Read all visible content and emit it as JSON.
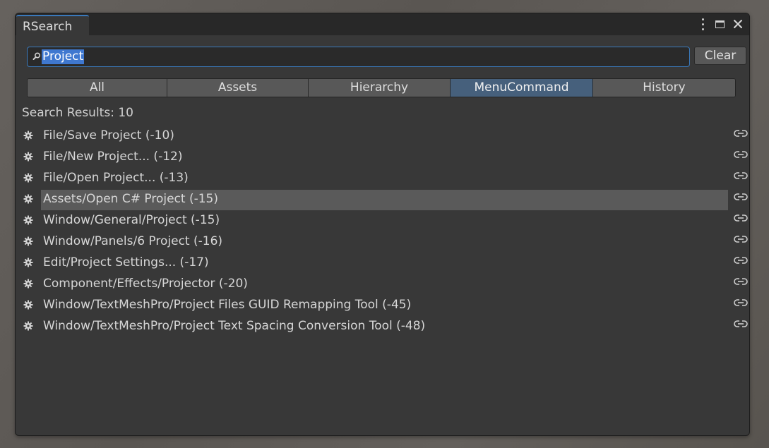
{
  "window": {
    "tab_title": "RSearch",
    "menu_icon": "kebab-menu-icon",
    "maximize_icon": "maximize-icon",
    "close_icon": "close-icon"
  },
  "search": {
    "value": "Project",
    "icon": "search-icon",
    "clear_label": "Clear"
  },
  "filters": [
    {
      "label": "All",
      "active": false
    },
    {
      "label": "Assets",
      "active": false
    },
    {
      "label": "Hierarchy",
      "active": false
    },
    {
      "label": "MenuCommand",
      "active": true
    },
    {
      "label": "History",
      "active": false
    }
  ],
  "results_count_label": "Search Results: 10",
  "results": [
    {
      "label": "File/Save Project (-10)",
      "selected": false
    },
    {
      "label": "File/New Project... (-12)",
      "selected": false
    },
    {
      "label": "File/Open Project... (-13)",
      "selected": false
    },
    {
      "label": "Assets/Open C# Project (-15)",
      "selected": true
    },
    {
      "label": "Window/General/Project (-15)",
      "selected": false
    },
    {
      "label": "Window/Panels/6 Project (-16)",
      "selected": false
    },
    {
      "label": "Edit/Project Settings... (-17)",
      "selected": false
    },
    {
      "label": "Component/Effects/Projector (-20)",
      "selected": false
    },
    {
      "label": "Window/TextMeshPro/Project Files GUID Remapping Tool (-45)",
      "selected": false
    },
    {
      "label": "Window/TextMeshPro/Project Text Spacing Conversion Tool (-48)",
      "selected": false
    }
  ],
  "icons": {
    "row_icon": "gear-icon",
    "link_icon": "link-icon"
  },
  "colors": {
    "accent": "#3a79bb",
    "active_tab": "#46607c",
    "selection": "#5a5a5a",
    "text_highlight": "#3f78d0"
  }
}
